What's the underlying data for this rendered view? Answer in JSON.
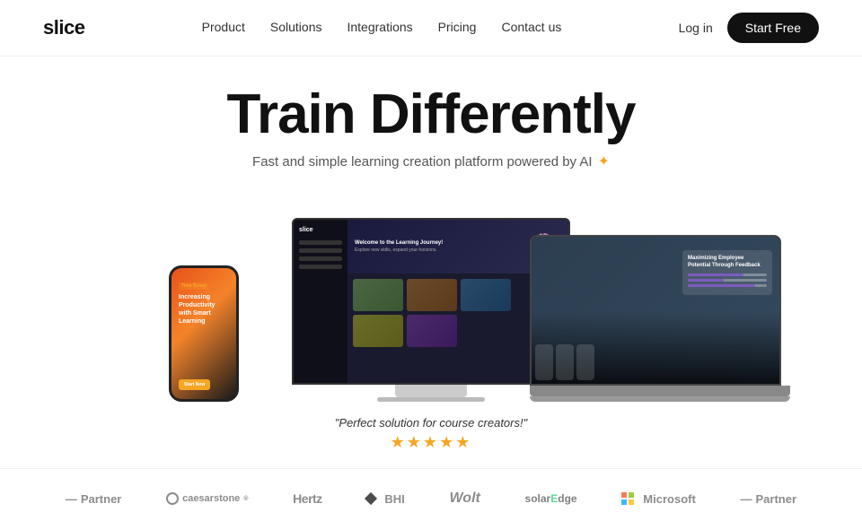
{
  "nav": {
    "logo": "slice",
    "links": [
      "Product",
      "Solutions",
      "Integrations",
      "Pricing",
      "Contact us"
    ],
    "login": "Log in",
    "cta": "Start Free"
  },
  "hero": {
    "title": "Train Differently",
    "subtitle": "Fast and simple learning creation platform powered by AI",
    "ai_icon": "✦"
  },
  "mockups": {
    "desktop": {
      "logo": "slice",
      "banner_title": "slice",
      "banner_subtitle": "Welcome to the Learning Journey!",
      "banner_sub2": "Explore new skills, expand your horizons."
    },
    "laptop": {
      "card_title": "Maximizing Employee Potential Through Feedback"
    },
    "phone": {
      "tag": "Time Boost",
      "title": "Increasing Productivity with Smart Learning",
      "cta": "Start Now"
    }
  },
  "quote": {
    "text": "\"Perfect solution for course creators!\"",
    "stars": "★★★★★"
  },
  "partners": [
    {
      "id": "partner1",
      "label": "-Partner",
      "type": "text-dash"
    },
    {
      "id": "caesarstone",
      "label": "caesarstone",
      "type": "circle-text"
    },
    {
      "id": "hertz",
      "label": "Hertz",
      "type": "bold"
    },
    {
      "id": "bhi",
      "label": "BHI",
      "type": "diamond-text"
    },
    {
      "id": "wolt",
      "label": "Wolt",
      "type": "italic"
    },
    {
      "id": "solaredge",
      "label": "solarEdge",
      "type": "solar"
    },
    {
      "id": "microsoft",
      "label": "Microsoft",
      "type": "ms-grid"
    },
    {
      "id": "partner2",
      "label": "-Partner",
      "type": "text-dash"
    }
  ]
}
